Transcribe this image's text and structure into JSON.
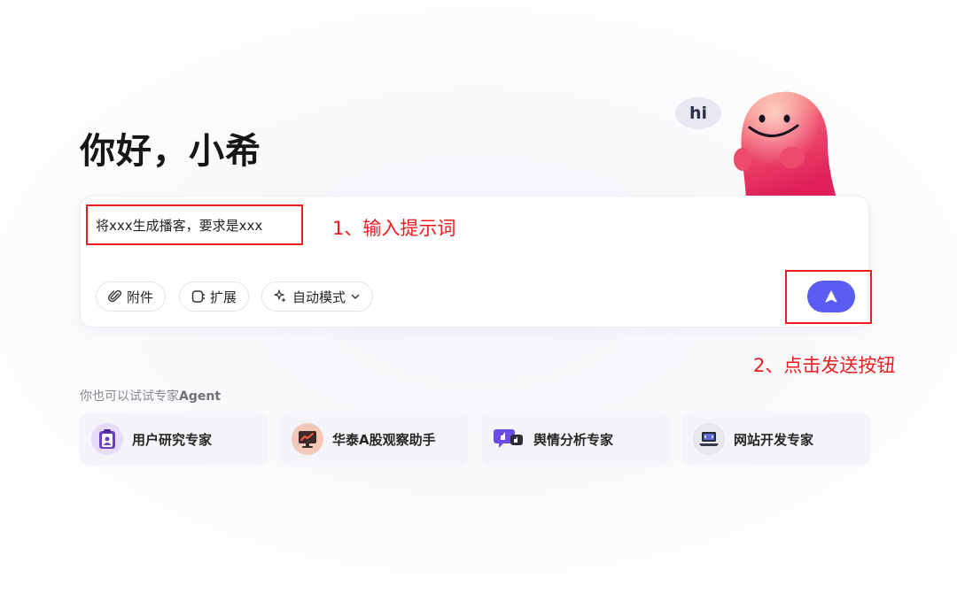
{
  "greeting": "你好，小希",
  "mascot": {
    "bubble_text": "hi"
  },
  "input": {
    "value": "将xxx生成播客，要求是xxx"
  },
  "toolbar": {
    "attach_label": "附件",
    "extend_label": "扩展",
    "mode_label": "自动模式"
  },
  "annotations": {
    "step1": "1、输入提示词",
    "step2": "2、点击发送按钮",
    "color": "#ee1c1c"
  },
  "experts": {
    "title_prefix": "你也可以试试专家",
    "title_suffix": "Agent",
    "items": [
      {
        "label": "用户研究专家",
        "icon": "clipboard-user-icon"
      },
      {
        "label": "华泰A股观察助手",
        "icon": "stock-chart-icon"
      },
      {
        "label": "舆情分析专家",
        "icon": "thumbs-up-chat-icon"
      },
      {
        "label": "网站开发专家",
        "icon": "laptop-code-icon"
      }
    ]
  },
  "colors": {
    "accent": "#5b5cf2",
    "mascot": "#f0506e"
  }
}
